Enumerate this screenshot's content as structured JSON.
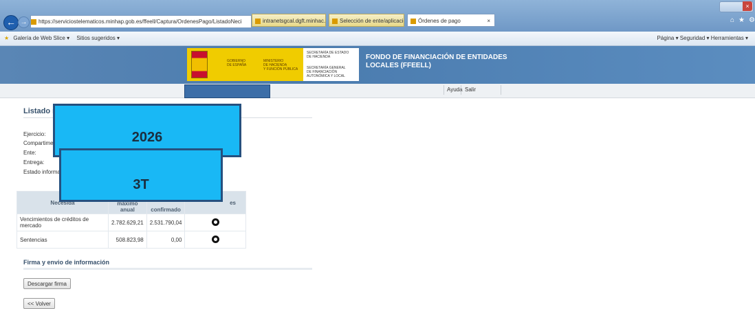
{
  "browser": {
    "address": "https://serviciostelematicos.minhap.gob.es/ffeell/Captura/OrdenesPago/ListadoNeci",
    "address_domain_bold": "minhap.gob.es",
    "tabs": [
      {
        "label": "intranetsgcal.dgft.minhac.age"
      },
      {
        "label": "Selección de ente/aplicación - ..."
      },
      {
        "label": "Órdenes de pago",
        "active": true
      }
    ],
    "favorites": [
      "Galería de Web Slice ▾",
      "Sitios sugeridos ▾"
    ],
    "commandbar": "Página ▾   Seguridad ▾   Herramientas ▾"
  },
  "header": {
    "gov_lines": [
      "GOBIERNO",
      "DE ESPAÑA"
    ],
    "ministry_lines": [
      "MINISTERIO",
      "DE HACIENDA",
      "Y FUNCIÓN PÚBLICA"
    ],
    "secretaria_lines": [
      "SECRETARÍA DE ESTADO",
      "DE HACIENDA"
    ],
    "secretaria_general_lines": [
      "SECRETARÍA GENERAL",
      "DE FINANCIACIÓN",
      "AUTONÓMICA Y LOCAL"
    ],
    "site_title_lines": [
      "FONDO DE FINANCIACIÓN DE ENTIDADES",
      "LOCALES (FFEELL)"
    ]
  },
  "menu": {
    "help": "Ayuda",
    "logout": "Salir"
  },
  "page": {
    "title": "Listado ne",
    "fields": [
      "Ejercicio:",
      "Compartimento",
      "Ente:",
      "Entrega:",
      "Estado informació"
    ],
    "table": {
      "headers": [
        "Necesida",
        "máximo anual",
        "confirmado",
        "es"
      ],
      "rows": [
        {
          "name": "Vencimientos de créditos de mercado",
          "max": "2.782.629,21",
          "confirmed": "2.531.790,04"
        },
        {
          "name": "Sentencias",
          "max": "508.823,98",
          "confirmed": "0,00"
        }
      ]
    },
    "section_title": "Firma y envio de información",
    "download_button": "Descargar firma",
    "back_button": "<< Volver"
  },
  "overlays": {
    "year": "2026",
    "period": "3T"
  },
  "colors": {
    "overlay_fill": "#19b8f5",
    "overlay_border": "#25507f",
    "banner": "#4a7bae",
    "gov_yellow": "#f0cc00"
  }
}
